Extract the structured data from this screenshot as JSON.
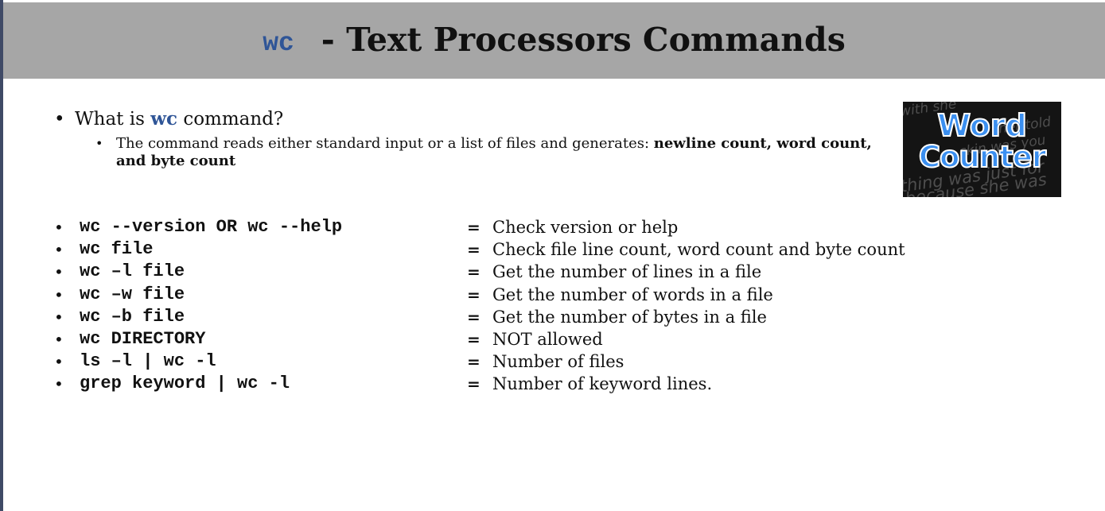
{
  "title": {
    "command": "wc",
    "text": "- Text Processors Commands"
  },
  "intro": {
    "bullet": "•",
    "question_prefix": "What is",
    "question_command": "wc",
    "question_suffix": "command?",
    "sub_bullet": "•",
    "sub_text": "The command reads either standard input or a list of files and generates:",
    "sub_bold": "newline count, word count, and byte count"
  },
  "logo": {
    "word": "Word",
    "counter": "Counter",
    "background_text": [
      "with she",
      "her told",
      "ckin was you",
      "thing was just for",
      "because she was"
    ]
  },
  "commands": [
    {
      "cmd": "wc --version OR wc --help",
      "eq": "=",
      "desc": "Check version or help"
    },
    {
      "cmd": "wc file",
      "eq": "=",
      "desc": "Check file line count, word count and byte count"
    },
    {
      "cmd": "wc –l file",
      "eq": "=",
      "desc": "Get the number of lines in a file"
    },
    {
      "cmd": "wc –w file",
      "eq": "=",
      "desc": "Get the number of words in a file"
    },
    {
      "cmd": "wc –b file",
      "eq": "=",
      "desc": "Get the number of bytes in a file"
    },
    {
      "cmd": "wc DIRECTORY",
      "eq": "=",
      "desc": "NOT allowed"
    },
    {
      "cmd": "ls –l | wc -l",
      "eq": "=",
      "desc": "Number of files"
    },
    {
      "cmd": "grep keyword | wc -l",
      "eq": "=",
      "desc": "Number of keyword lines."
    }
  ],
  "colors": {
    "header_background": "#a6a6a6",
    "accent": "#2f5597",
    "text": "#111111",
    "logo_text": "#3b8ff0"
  }
}
